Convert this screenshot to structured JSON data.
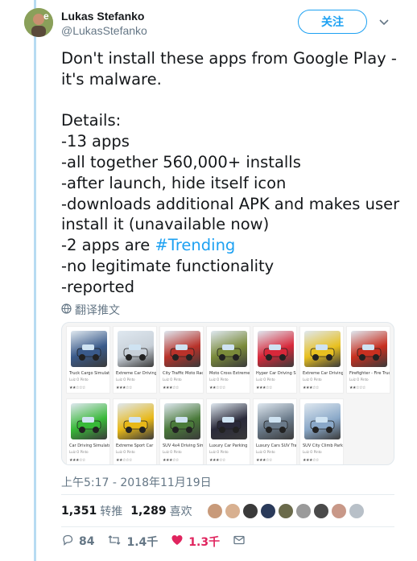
{
  "user": {
    "display_name": "Lukas Stefanko",
    "handle": "@LukasStefanko"
  },
  "follow_label": "关注",
  "tweet": {
    "text_before_hashtag": "Don't install these apps from Google Play -  it's malware.\n\nDetails:\n-13 apps\n-all together 560,000+ installs\n-after launch, hide itself icon\n-downloads additional APK and makes user install it (unavailable now)\n-2 apps are ",
    "hashtag": "#Trending",
    "text_after_hashtag": "\n-no legitimate functionality\n-reported"
  },
  "translate_label": "翻译推文",
  "apps": [
    {
      "title": "Truck Cargo Simulator",
      "dev": "Luiz O Pinto",
      "stars": "★★☆☆☆",
      "color": "#3a5a8a"
    },
    {
      "title": "Extreme Car Driving",
      "dev": "Luiz O Pinto",
      "stars": "★★★☆☆",
      "color": "#c8d0d8"
    },
    {
      "title": "City Traffic Moto Racer",
      "dev": "Luiz O Pinto",
      "stars": "★★★☆☆",
      "color": "#b8322a"
    },
    {
      "title": "Moto Cross Extreme",
      "dev": "Luiz O Pinto",
      "stars": "★★☆☆☆",
      "color": "#7a8a3a"
    },
    {
      "title": "Hyper Car Driving Sim",
      "dev": "Luiz O Pinto",
      "stars": "★★★☆☆",
      "color": "#d8283a"
    },
    {
      "title": "Extreme Car Driving",
      "dev": "Luiz O Pinto",
      "stars": "★★★☆☆",
      "color": "#e8c020"
    },
    {
      "title": "Firefighter - Fire Truck",
      "dev": "Luiz O Pinto",
      "stars": "★★☆☆☆",
      "color": "#c83020"
    },
    {
      "title": "Car Driving Simulator",
      "dev": "Luiz O Pinto",
      "stars": "★★★☆☆",
      "color": "#38b838"
    },
    {
      "title": "Extreme Sport Car",
      "dev": "Luiz O Pinto",
      "stars": "★★☆☆☆",
      "color": "#e8b818"
    },
    {
      "title": "SUV 4x4 Driving Sim",
      "dev": "Luiz O Pinto",
      "stars": "★★★☆☆",
      "color": "#4a7a3a"
    },
    {
      "title": "Luxury Car Parking",
      "dev": "Luiz O Pinto",
      "stars": "★★★☆☆",
      "color": "#2a2a3a"
    },
    {
      "title": "Luxury Cars SUV Traffic",
      "dev": "Luiz O Pinto",
      "stars": "★★★☆☆",
      "color": "#6a7a8a"
    },
    {
      "title": "SUV City Climb Parking",
      "dev": "Luiz O Pinto",
      "stars": "★★★☆☆",
      "color": "#8aa8c8"
    }
  ],
  "timestamp": "上午5:17 - 2018年11月19日",
  "stats": {
    "retweets_count": "1,351",
    "retweets_label": "转推",
    "likes_count": "1,289",
    "likes_label": "喜欢"
  },
  "liker_colors": [
    "#c89a7a",
    "#d8b090",
    "#3a3a3a",
    "#2a3a5a",
    "#6a6a4a",
    "#9a9a9a",
    "#4a4a4a",
    "#c89888",
    "#b8c0c8"
  ],
  "actions": {
    "replies": "84",
    "retweets": "1.4千",
    "likes": "1.3千"
  },
  "colors": {
    "accent": "#1da1f2",
    "like": "#e0245e",
    "muted": "#657786"
  }
}
